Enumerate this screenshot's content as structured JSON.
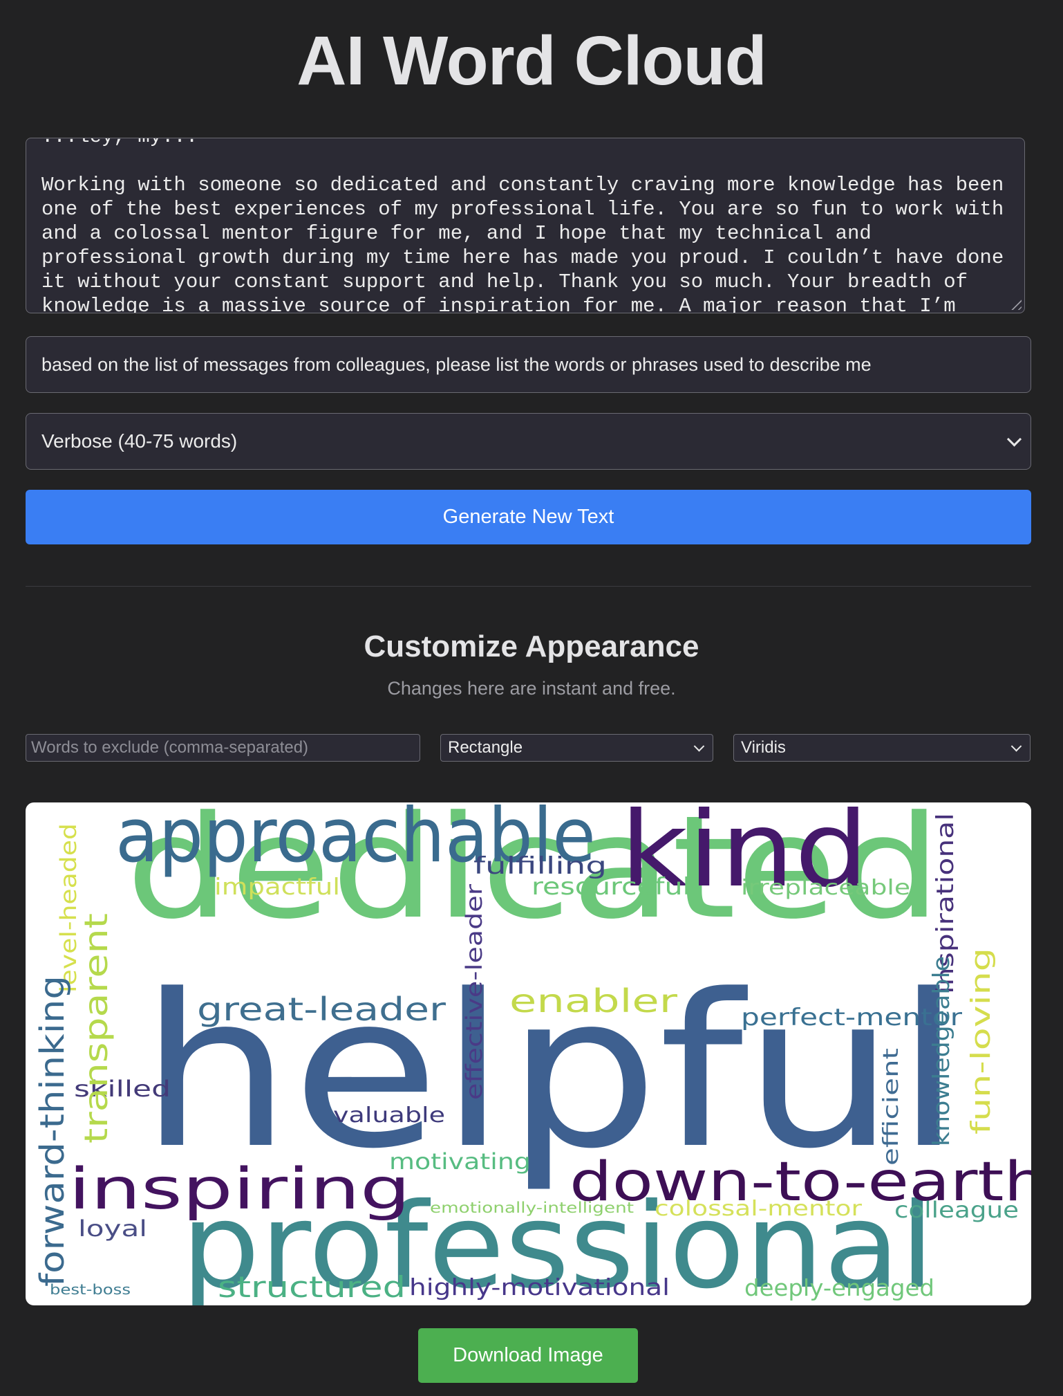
{
  "app": {
    "title": "AI Word Cloud"
  },
  "source": {
    "partial_line": "...ley, my...",
    "text": "Working with someone so dedicated and constantly craving more knowledge has been one of the best experiences of my professional life. You are so fun to work with and a colossal mentor figure for me, and I hope that my technical and professional growth during my time here has made you proud. I couldn’t have done it without your constant support and help. Thank you so much. Your breadth of knowledge is a massive source of inspiration for me. A major reason that I’m"
  },
  "prompt": {
    "value": "based on the list of messages from colleagues, please list the words or phrases used to describe me"
  },
  "length": {
    "selected": "Verbose (40-75 words)"
  },
  "generate_label": "Generate New Text",
  "appearance": {
    "title": "Customize Appearance",
    "subtitle": "Changes here are instant and free.",
    "exclude_placeholder": "Words to exclude (comma-separated)",
    "shape_selected": "Rectangle",
    "colormap_selected": "Viridis"
  },
  "cloud": {
    "words": [
      {
        "text": "helpful",
        "color": "#3e6090"
      },
      {
        "text": "dedicated",
        "color": "#6cc779"
      },
      {
        "text": "professional",
        "color": "#3f8a8d"
      },
      {
        "text": "approachable",
        "color": "#3a6b8e"
      },
      {
        "text": "kind",
        "color": "#45196b"
      },
      {
        "text": "inspiring",
        "color": "#43135f"
      },
      {
        "text": "down-to-earth",
        "color": "#3d0f55"
      },
      {
        "text": "great-leader",
        "color": "#3f6f8f"
      },
      {
        "text": "enabler",
        "color": "#c3d94b"
      },
      {
        "text": "perfect-mentor",
        "color": "#3a7192"
      },
      {
        "text": "fulfilling",
        "color": "#3b477f"
      },
      {
        "text": "resourceful",
        "color": "#6cc779"
      },
      {
        "text": "irreplaceable",
        "color": "#76c97a"
      },
      {
        "text": "impactful",
        "color": "#cfe05a"
      },
      {
        "text": "skilled",
        "color": "#433a78"
      },
      {
        "text": "valuable",
        "color": "#3e3a7b"
      },
      {
        "text": "motivating",
        "color": "#57bc81"
      },
      {
        "text": "emotionally-intelligent",
        "color": "#8ed06d"
      },
      {
        "text": "colossal-mentor",
        "color": "#d5e15a"
      },
      {
        "text": "colleague",
        "color": "#4aa28a"
      },
      {
        "text": "loyal",
        "color": "#4a4e86"
      },
      {
        "text": "structured",
        "color": "#4bb184"
      },
      {
        "text": "highly-motivational",
        "color": "#47378a"
      },
      {
        "text": "deeply-engaged",
        "color": "#70c77a"
      },
      {
        "text": "best-boss",
        "color": "#3f7d92"
      },
      {
        "text": "transparent",
        "color": "#b5d94c"
      },
      {
        "text": "level-headed",
        "color": "#d6e04d"
      },
      {
        "text": "forward-thinking",
        "color": "#3b6a8e"
      },
      {
        "text": "effective-leader",
        "color": "#4a3a86"
      },
      {
        "text": "inspirational",
        "color": "#47317b"
      },
      {
        "text": "knowledgeable",
        "color": "#3c7d90"
      },
      {
        "text": "fun-loving",
        "color": "#d5dd4d"
      },
      {
        "text": "efficient",
        "color": "#3f6b92"
      }
    ]
  },
  "download_label": "Download Image"
}
